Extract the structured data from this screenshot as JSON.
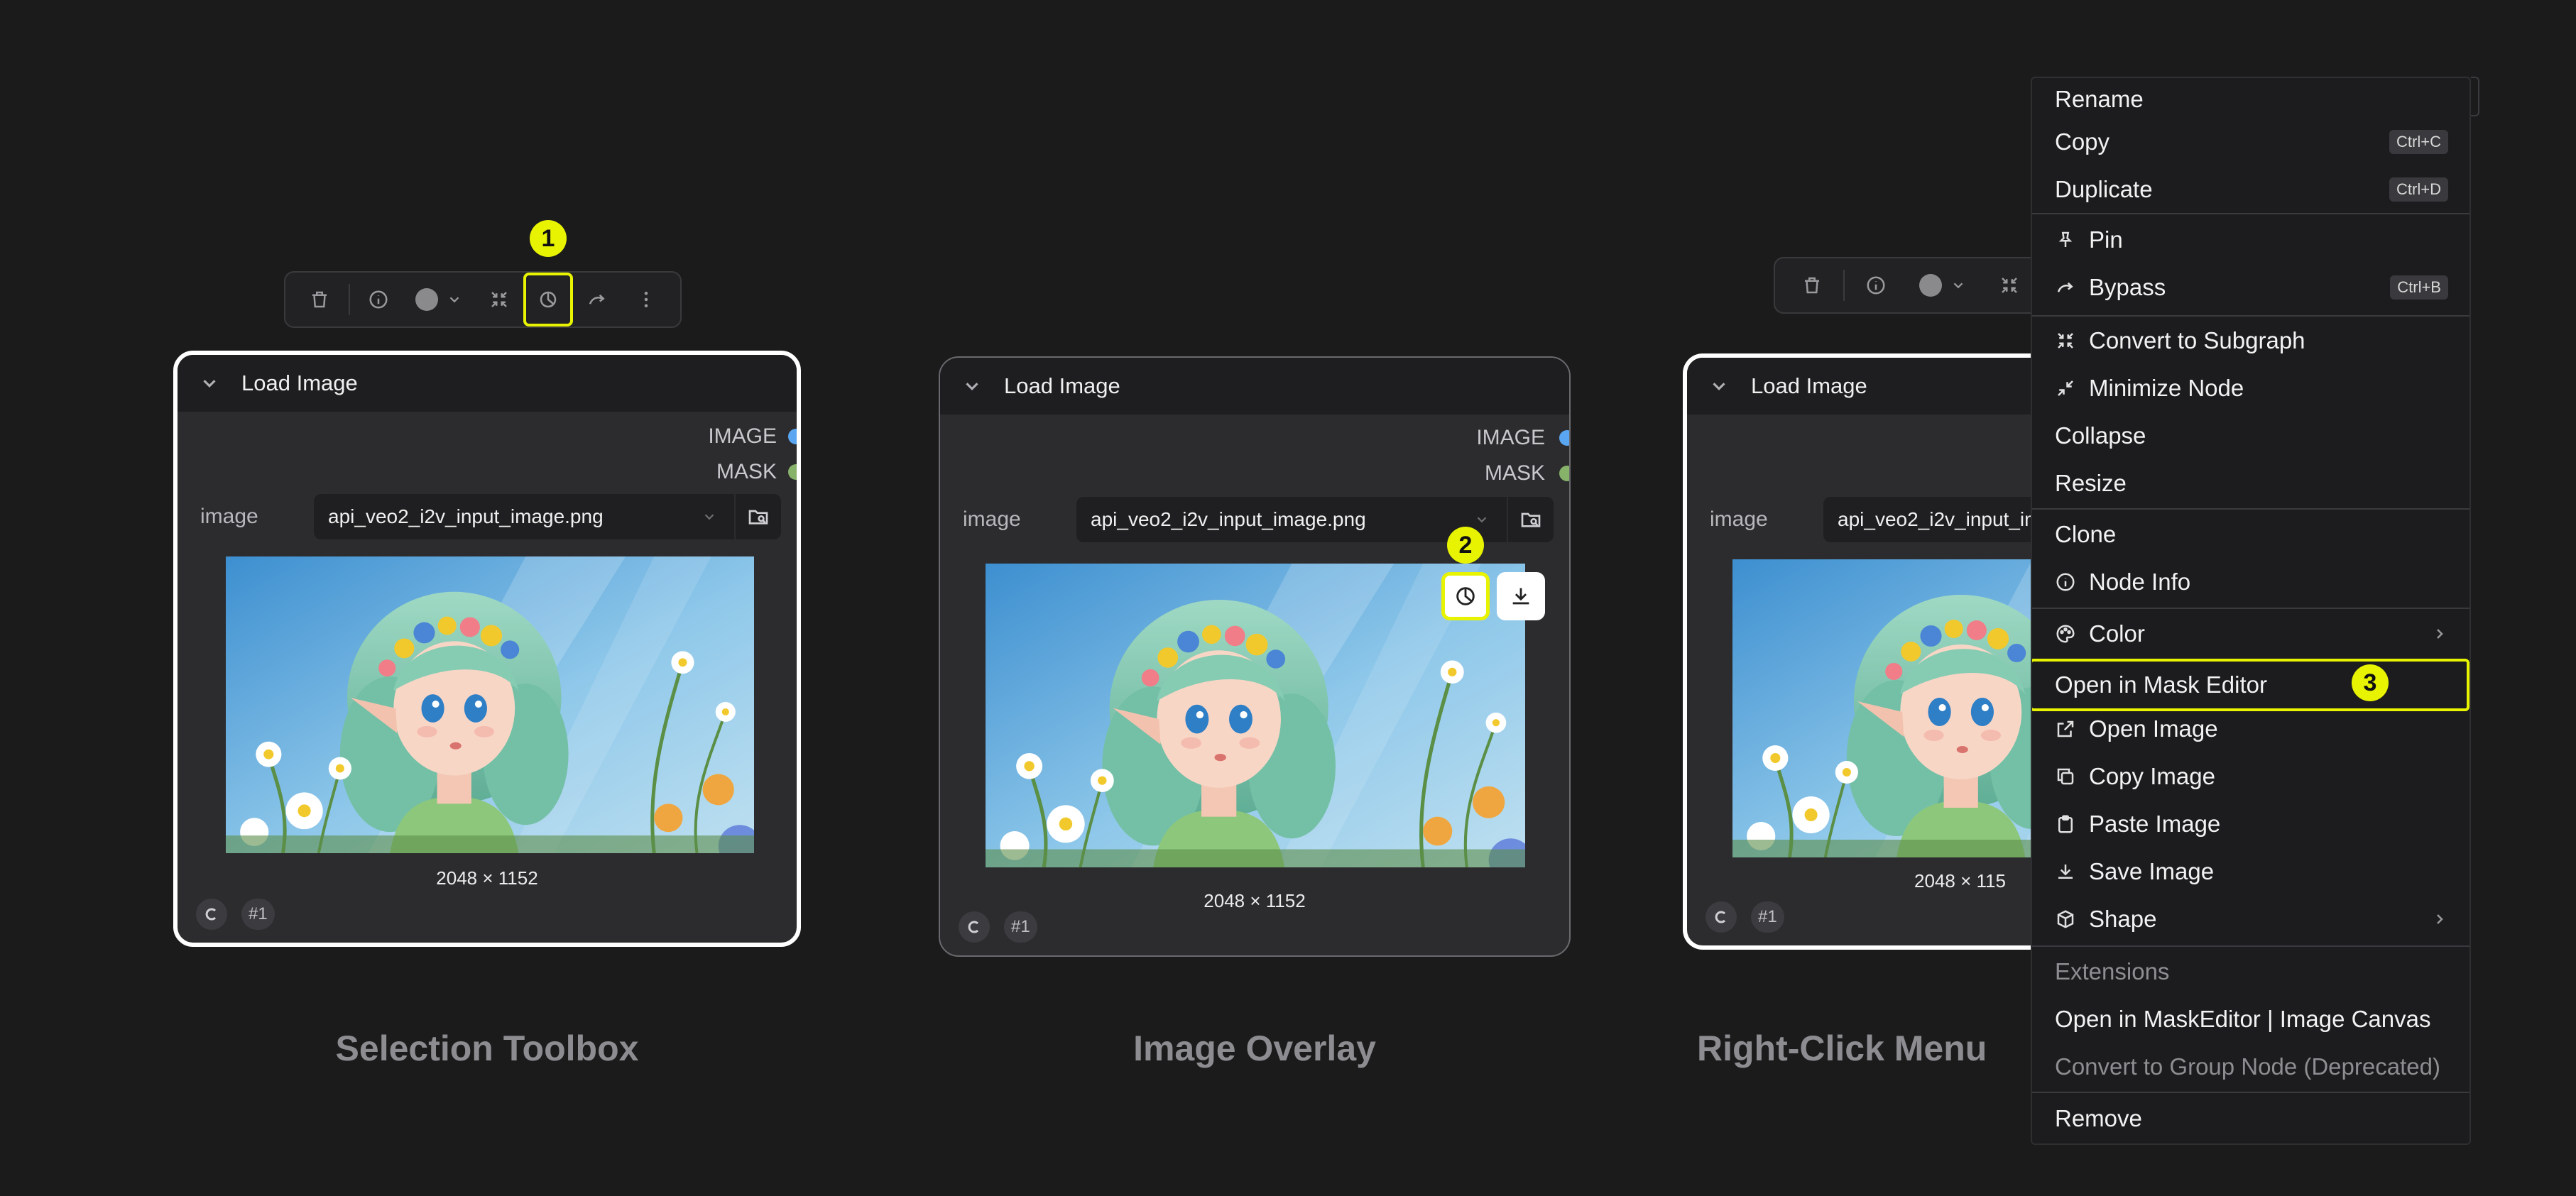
{
  "node": {
    "title": "Load Image",
    "outputs": [
      "IMAGE",
      "MASK"
    ],
    "output_colors": [
      "#5aa6f0",
      "#86b26a"
    ],
    "widget_label": "image",
    "widget_value": "api_veo2_i2v_input_image.png",
    "widget_value_truncated": "api_veo2_i2v_input_im",
    "dimensions": "2048 × 1152",
    "dimensions_truncated": "2048 × 115",
    "id_badge": "#1"
  },
  "badges": {
    "one": "1",
    "two": "2",
    "three": "3"
  },
  "captions": {
    "selection_toolbox": "Selection Toolbox",
    "image_overlay": "Image Overlay",
    "right_click_menu": "Right-Click Menu"
  },
  "toolbox_icons": [
    "trash-icon",
    "info-icon",
    "color-dot-icon",
    "chevron-down-icon",
    "minimize-icon",
    "mask-editor-icon",
    "bypass-icon",
    "more-vertical-icon"
  ],
  "accent": "#e7f300",
  "menu": {
    "items": [
      {
        "label": "Rename"
      },
      {
        "label": "Copy",
        "shortcut": "Ctrl+C"
      },
      {
        "label": "Duplicate",
        "shortcut": "Ctrl+D"
      },
      {
        "label": "Pin",
        "icon": "pin-icon"
      },
      {
        "label": "Bypass",
        "icon": "bypass-icon",
        "shortcut": "Ctrl+B"
      },
      {
        "label": "Convert to Subgraph",
        "icon": "convert-subgraph-icon"
      },
      {
        "label": "Minimize Node",
        "icon": "minimize-icon"
      },
      {
        "label": "Collapse"
      },
      {
        "label": "Resize"
      },
      {
        "label": "Clone"
      },
      {
        "label": "Node Info",
        "icon": "info-icon"
      },
      {
        "label": "Color",
        "icon": "palette-icon"
      },
      {
        "label": "Open in Mask Editor"
      },
      {
        "label": "Open Image",
        "icon": "external-link-icon"
      },
      {
        "label": "Copy Image",
        "icon": "copy-icon"
      },
      {
        "label": "Paste Image",
        "icon": "clipboard-icon"
      },
      {
        "label": "Save Image",
        "icon": "download-icon"
      },
      {
        "label": "Shape",
        "icon": "box-icon"
      },
      {
        "label": "Extensions"
      },
      {
        "label": "Open in MaskEditor | Image Canvas"
      },
      {
        "label": "Convert to Group Node (Deprecated)"
      },
      {
        "label": "Remove"
      }
    ]
  }
}
